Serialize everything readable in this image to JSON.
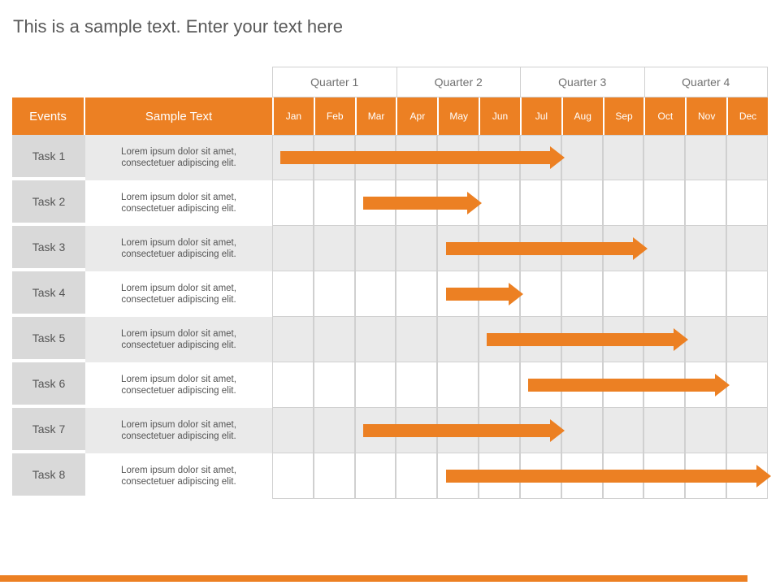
{
  "title": "This is a sample text. Enter your text here",
  "headers": {
    "events": "Events",
    "sample_text": "Sample Text"
  },
  "quarters": [
    "Quarter 1",
    "Quarter 2",
    "Quarter 3",
    "Quarter 4"
  ],
  "months": [
    "Jan",
    "Feb",
    "Mar",
    "Apr",
    "May",
    "Jun",
    "Jul",
    "Aug",
    "Sep",
    "Oct",
    "Nov",
    "Dec"
  ],
  "tasks": [
    {
      "name": "Task 1",
      "desc": "Lorem ipsum dolor sit amet, consectetuer adipiscing elit.",
      "start": 1,
      "end": 7
    },
    {
      "name": "Task 2",
      "desc": "Lorem ipsum dolor sit amet, consectetuer adipiscing elit.",
      "start": 3,
      "end": 5
    },
    {
      "name": "Task 3",
      "desc": "Lorem ipsum dolor sit amet, consectetuer adipiscing elit.",
      "start": 5,
      "end": 9
    },
    {
      "name": "Task 4",
      "desc": "Lorem ipsum dolor sit amet, consectetuer adipiscing elit.",
      "start": 5,
      "end": 6
    },
    {
      "name": "Task 5",
      "desc": "Lorem ipsum dolor sit amet, consectetuer adipiscing elit.",
      "start": 6,
      "end": 10
    },
    {
      "name": "Task 6",
      "desc": "Lorem ipsum dolor sit amet, consectetuer adipiscing elit.",
      "start": 7,
      "end": 11
    },
    {
      "name": "Task 7",
      "desc": "Lorem ipsum dolor sit amet, consectetuer adipiscing elit.",
      "start": 3,
      "end": 7
    },
    {
      "name": "Task 8",
      "desc": "Lorem ipsum dolor sit amet, consectetuer adipiscing elit.",
      "start": 5,
      "end": 12
    }
  ],
  "colors": {
    "accent": "#ec8023",
    "gray": "#d9d9d9"
  },
  "chart_data": {
    "type": "bar",
    "orientation": "gantt",
    "title": "This is a sample text. Enter your text here",
    "xlabel": "",
    "ylabel": "",
    "categories": [
      "Task 1",
      "Task 2",
      "Task 3",
      "Task 4",
      "Task 5",
      "Task 6",
      "Task 7",
      "Task 8"
    ],
    "x_ticks": [
      "Jan",
      "Feb",
      "Mar",
      "Apr",
      "May",
      "Jun",
      "Jul",
      "Aug",
      "Sep",
      "Oct",
      "Nov",
      "Dec"
    ],
    "x_groups": [
      "Quarter 1",
      "Quarter 2",
      "Quarter 3",
      "Quarter 4"
    ],
    "series": [
      {
        "name": "Task 1",
        "start": 1,
        "end": 7
      },
      {
        "name": "Task 2",
        "start": 3,
        "end": 5
      },
      {
        "name": "Task 3",
        "start": 5,
        "end": 9
      },
      {
        "name": "Task 4",
        "start": 5,
        "end": 6
      },
      {
        "name": "Task 5",
        "start": 6,
        "end": 10
      },
      {
        "name": "Task 6",
        "start": 7,
        "end": 11
      },
      {
        "name": "Task 7",
        "start": 3,
        "end": 7
      },
      {
        "name": "Task 8",
        "start": 5,
        "end": 12
      }
    ],
    "xlim": [
      1,
      12
    ]
  }
}
